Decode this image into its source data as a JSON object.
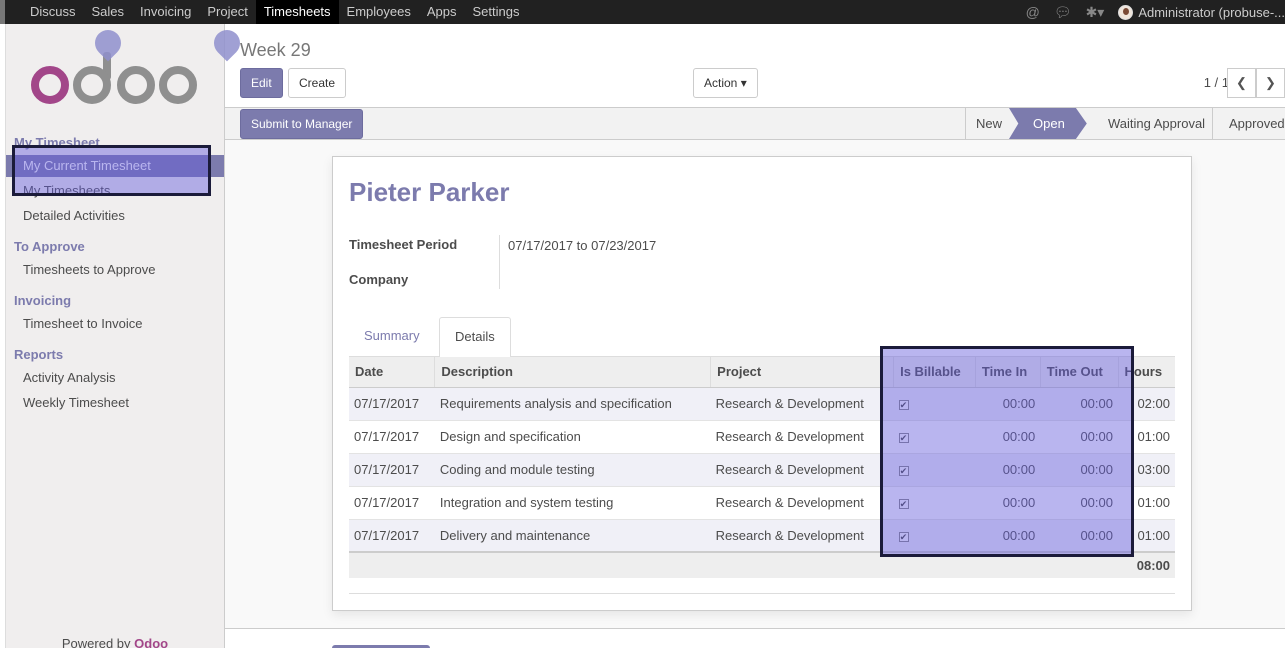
{
  "topbar": {
    "apps": [
      "Discuss",
      "Sales",
      "Invoicing",
      "Project",
      "Timesheets",
      "Employees",
      "Apps",
      "Settings"
    ],
    "active_app": "Timesheets",
    "user": "Administrator (probuse-..."
  },
  "sidebar": {
    "sections": [
      {
        "title": "My Timesheet",
        "items": [
          "My Current Timesheet",
          "My Timesheets",
          "Detailed Activities"
        ]
      },
      {
        "title": "To Approve",
        "items": [
          "Timesheets to Approve"
        ]
      },
      {
        "title": "Invoicing",
        "items": [
          "Timesheet to Invoice"
        ]
      },
      {
        "title": "Reports",
        "items": [
          "Activity Analysis",
          "Weekly Timesheet"
        ]
      }
    ],
    "active_item": "My Current Timesheet",
    "powered_prefix": "Powered by",
    "powered_brand": "Odoo"
  },
  "control_panel": {
    "breadcrumb": "Week 29",
    "edit_label": "Edit",
    "create_label": "Create",
    "action_label": "Action",
    "pager": "1 / 1"
  },
  "statusbar": {
    "submit_label": "Submit to Manager",
    "stages": [
      "New",
      "Open",
      "Waiting Approval",
      "Approved"
    ],
    "active_stage": "Open"
  },
  "form": {
    "employee": "Pieter Parker",
    "period_label": "Timesheet Period",
    "period_value": "07/17/2017 to 07/23/2017",
    "company_label": "Company",
    "company_value": "",
    "tabs": [
      "Summary",
      "Details"
    ],
    "active_tab": "Details"
  },
  "details_table": {
    "columns": [
      "Date",
      "Description",
      "Project",
      "",
      "Is Billable",
      "Time In",
      "Time Out",
      "Hours"
    ],
    "rows": [
      {
        "date": "07/17/2017",
        "description": "Requirements analysis and specification",
        "project": "Research & Development",
        "billable": true,
        "time_in": "00:00",
        "time_out": "00:00",
        "hours": "02:00"
      },
      {
        "date": "07/17/2017",
        "description": "Design and specification",
        "project": "Research & Development",
        "billable": true,
        "time_in": "00:00",
        "time_out": "00:00",
        "hours": "01:00"
      },
      {
        "date": "07/17/2017",
        "description": "Coding and module testing",
        "project": "Research & Development",
        "billable": true,
        "time_in": "00:00",
        "time_out": "00:00",
        "hours": "03:00"
      },
      {
        "date": "07/17/2017",
        "description": "Integration and system testing",
        "project": "Research & Development",
        "billable": true,
        "time_in": "00:00",
        "time_out": "00:00",
        "hours": "01:00"
      },
      {
        "date": "07/17/2017",
        "description": "Delivery and maintenance",
        "project": "Research & Development",
        "billable": true,
        "time_in": "00:00",
        "time_out": "00:00",
        "hours": "01:00"
      }
    ],
    "total_hours": "08:00"
  },
  "colors": {
    "accent": "#7c7bad",
    "brand_o": "#a24689",
    "highlight": "#645adc",
    "highlight_box": "#1b1b3a"
  }
}
